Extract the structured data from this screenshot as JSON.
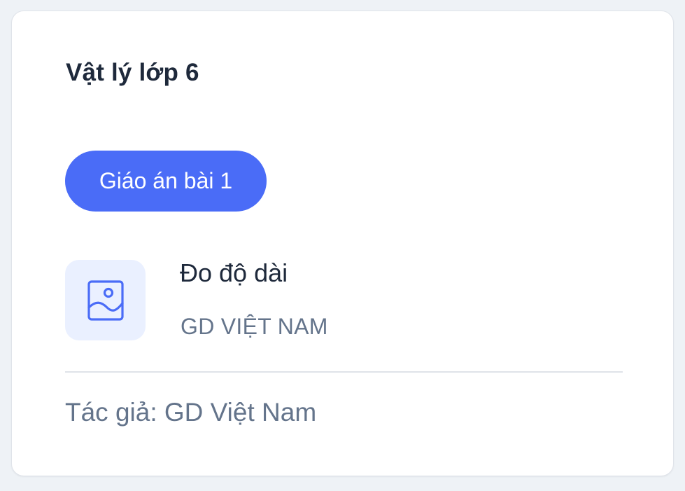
{
  "card": {
    "title": "Vật lý lớp 6",
    "tag_label": "Giáo án bài 1",
    "item": {
      "icon": "image-icon",
      "title": "Đo độ dài",
      "subtitle": "GD VIỆT NAM"
    },
    "author": "Tác giả: GD Việt Nam"
  },
  "colors": {
    "accent": "#4a6cf7",
    "thumb_bg": "#eaf0ff",
    "text_dark": "#1e293b",
    "text_muted": "#64748b",
    "page_bg": "#eef2f6"
  }
}
